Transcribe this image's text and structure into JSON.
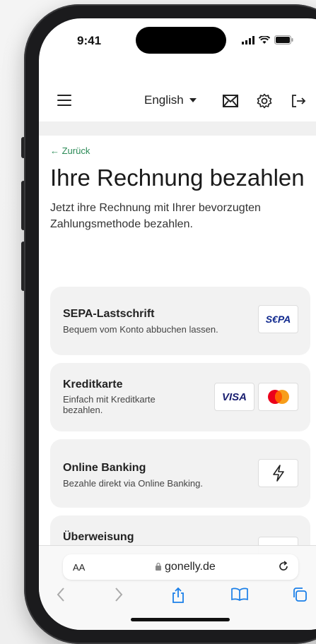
{
  "status": {
    "time": "9:41"
  },
  "header": {
    "language": "English"
  },
  "page": {
    "back_label": "← Zurück",
    "title": "Ihre Rechnung bezahlen",
    "lead": "Jetzt ihre Rechnung mit Ihrer bevorzugten Zahlungsmethode bezahlen."
  },
  "methods": [
    {
      "title": "SEPA-Lastschrift",
      "desc": "Bequem vom Konto abbuchen lassen."
    },
    {
      "title": "Kreditkarte",
      "desc": "Einfach mit Kreditkarte bezahlen.",
      "logo_visa": "VISA"
    },
    {
      "title": "Online Banking",
      "desc": "Bezahle direkt via Online Banking."
    },
    {
      "title": "Überweisung"
    }
  ],
  "logos": {
    "sepa": "S€PA"
  },
  "browser": {
    "aa": "AA",
    "url": "gonelly.de"
  },
  "colors": {
    "accent": "#2a8a56",
    "card": "#f2f2f2",
    "sepa_blue": "#10298e",
    "visa_blue": "#1a1f71"
  },
  "icons": [
    "menu-icon",
    "mail-icon",
    "gear-icon",
    "logout-icon",
    "lightning-icon",
    "lock-icon",
    "reload-icon",
    "back-icon",
    "forward-icon",
    "share-icon",
    "bookmarks-icon",
    "tabs-icon"
  ]
}
